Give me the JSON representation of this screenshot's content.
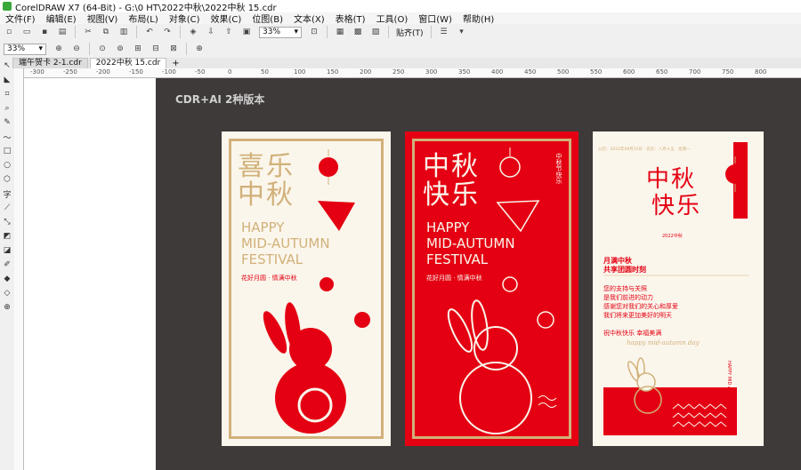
{
  "window": {
    "title": "CorelDRAW X7 (64-Bit) - G:\\0 HT\\2022中秋\\2022中秋 15.cdr"
  },
  "menu": [
    "文件(F)",
    "编辑(E)",
    "视图(V)",
    "布局(L)",
    "对象(C)",
    "效果(C)",
    "位图(B)",
    "文本(X)",
    "表格(T)",
    "工具(O)",
    "窗口(W)",
    "帮助(H)"
  ],
  "toolbar": {
    "zoom_value": "33%",
    "snap_label": "贴齐(T)"
  },
  "property_bar": {
    "zoom_value": "33%"
  },
  "tabs": [
    "端午贺卡 2-1.cdr",
    "2022中秋 15.cdr"
  ],
  "ruler_numbers": [
    "-300",
    "-250",
    "-200",
    "-150",
    "-100",
    "-50",
    "0",
    "50",
    "100",
    "150",
    "200",
    "250",
    "300",
    "350",
    "400",
    "450",
    "500",
    "550",
    "600",
    "650",
    "700",
    "750",
    "800"
  ],
  "canvas": {
    "version_label": "CDR+AI 2种版本"
  },
  "poster1": {
    "title_line1": "喜乐",
    "title_line2": "中秋",
    "en1": "HAPPY",
    "en2": "MID-AUTUMN",
    "en3": "FESTIVAL",
    "slogan": "花好月圆 · 情满中秋"
  },
  "poster2": {
    "title_line1": "中秋",
    "title_line2": "快乐",
    "en1": "HAPPY",
    "en2": "MID-AUTUMN",
    "en3": "FESTIVAL",
    "slogan": "花好月圆 · 情满中秋",
    "vertical": "中秋节快乐"
  },
  "poster3": {
    "header": "公历：2020年09月10日  ·  农历：八月十五  ·  星期一",
    "title_line1": "中秋",
    "title_line2": "快乐",
    "subtitle": "2022中秋",
    "heading1": "月满中秋",
    "heading2": "共享团圆时刻",
    "body": [
      "您的支持与关照",
      "是我们前进的动力",
      "感谢您对我们的关心和厚爱",
      "我们将来更加美好的明天"
    ],
    "wish": "祝中秋快乐  幸福美满",
    "script": "happy mid-autumn day",
    "vertical_en": "HAPPY MID AUTUMN FESTIVAL"
  },
  "colors": {
    "red": "#e40012",
    "gold": "#d1b17a",
    "cream": "#fbf6ec",
    "canvas": "#3e3a39"
  }
}
